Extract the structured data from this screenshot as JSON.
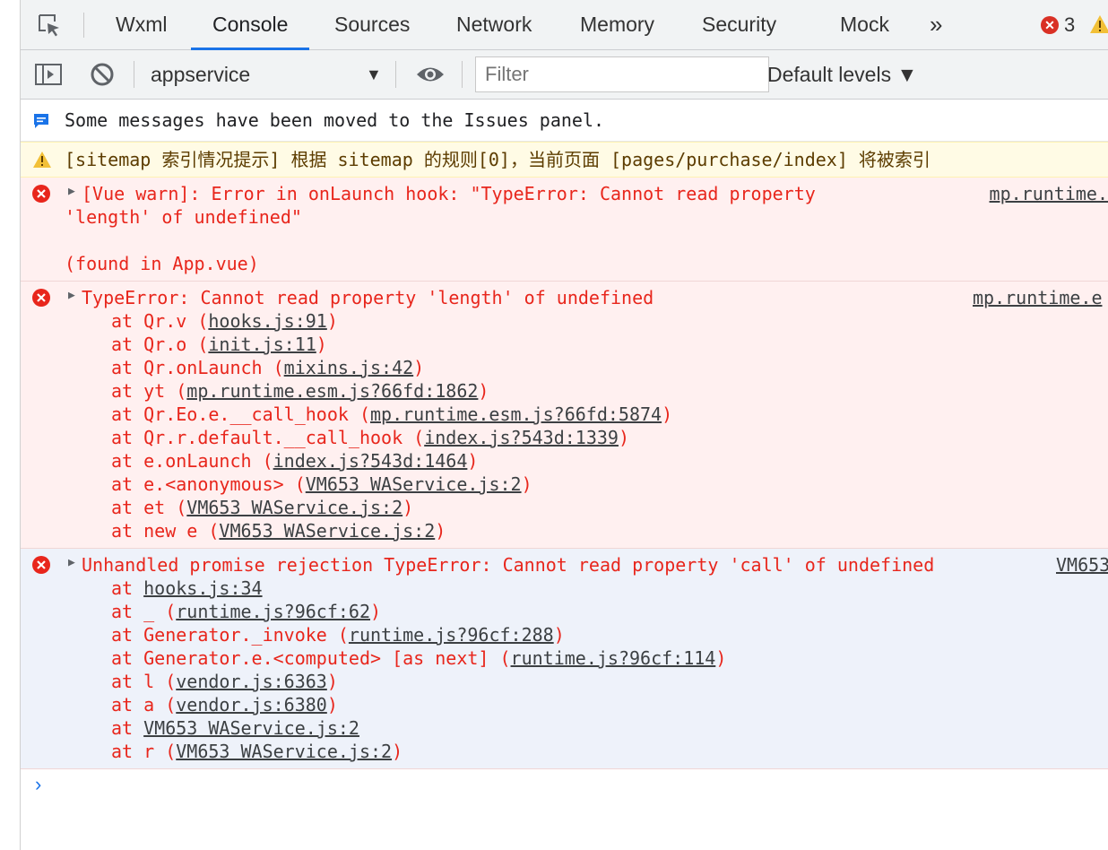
{
  "tabs": [
    {
      "label": "Wxml"
    },
    {
      "label": "Console"
    },
    {
      "label": "Sources"
    },
    {
      "label": "Network"
    },
    {
      "label": "Memory"
    },
    {
      "label": "Security"
    },
    {
      "label": "Mock"
    }
  ],
  "more_tabs": "»",
  "error_count": "3",
  "toolbar": {
    "context": "appservice",
    "context_arrow": "▼",
    "filter_placeholder": "Filter",
    "levels": "Default levels ▼"
  },
  "messages": {
    "info": "Some messages have been moved to the Issues panel.",
    "warn": "[sitemap 索引情况提示] 根据 sitemap 的规则[0]，当前页面 [pages/purchase/index] 将被索引",
    "err1": {
      "line1": "[Vue warn]: Error in onLaunch hook: \"TypeError: Cannot read property",
      "line2": "'length' of undefined\"",
      "line3": "(found in App.vue)",
      "source": "mp.runtime."
    },
    "err2": {
      "line1": "TypeError: Cannot read property 'length' of undefined",
      "source": "mp.runtime.e",
      "frames": [
        {
          "pre": "at Qr.v (",
          "link": "hooks.js:91",
          "post": ")"
        },
        {
          "pre": "at Qr.o (",
          "link": "init.js:11",
          "post": ")"
        },
        {
          "pre": "at Qr.onLaunch (",
          "link": "mixins.js:42",
          "post": ")"
        },
        {
          "pre": "at yt (",
          "link": "mp.runtime.esm.js?66fd:1862",
          "post": ")"
        },
        {
          "pre": "at Qr.Eo.e.__call_hook (",
          "link": "mp.runtime.esm.js?66fd:5874",
          "post": ")"
        },
        {
          "pre": "at Qr.r.default.__call_hook (",
          "link": "index.js?543d:1339",
          "post": ")"
        },
        {
          "pre": "at e.onLaunch (",
          "link": "index.js?543d:1464",
          "post": ")"
        },
        {
          "pre": "at e.<anonymous> (",
          "link": "VM653 WAService.js:2",
          "post": ")"
        },
        {
          "pre": "at et (",
          "link": "VM653 WAService.js:2",
          "post": ")"
        },
        {
          "pre": "at new e (",
          "link": "VM653 WAService.js:2",
          "post": ")"
        }
      ]
    },
    "err3": {
      "line1": "Unhandled promise rejection TypeError: Cannot read property 'call' of undefined",
      "source": "VM653",
      "frames": [
        {
          "pre": "at ",
          "link": "hooks.js:34",
          "post": ""
        },
        {
          "pre": "at _ (",
          "link": "runtime.js?96cf:62",
          "post": ")"
        },
        {
          "pre": "at Generator._invoke (",
          "link": "runtime.js?96cf:288",
          "post": ")"
        },
        {
          "pre": "at Generator.e.<computed> [as next] (",
          "link": "runtime.js?96cf:114",
          "post": ")"
        },
        {
          "pre": "at l (",
          "link": "vendor.js:6363",
          "post": ")"
        },
        {
          "pre": "at a (",
          "link": "vendor.js:6380",
          "post": ")"
        },
        {
          "pre": "at ",
          "link": "VM653 WAService.js:2",
          "post": ""
        },
        {
          "pre": "at r (",
          "link": "VM653 WAService.js:2",
          "post": ")"
        }
      ]
    }
  },
  "prompt": "›"
}
